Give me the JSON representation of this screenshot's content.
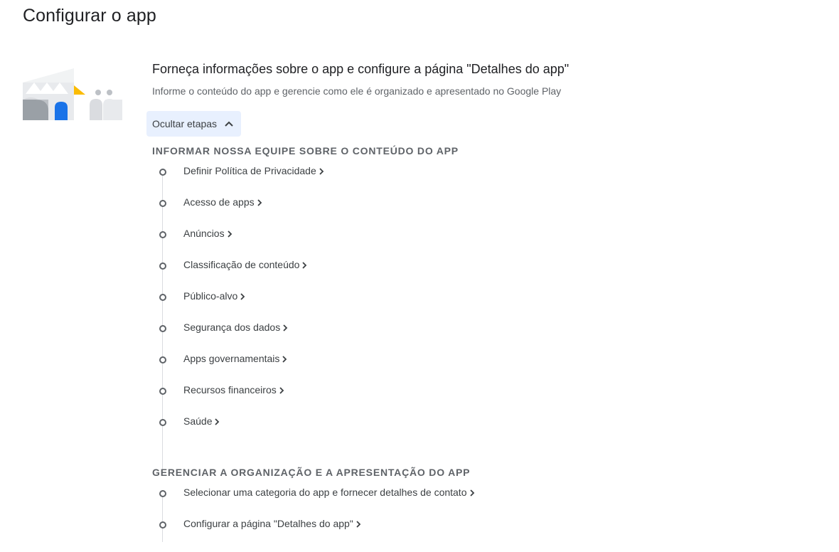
{
  "page": {
    "title": "Configurar o app"
  },
  "intro": {
    "heading": "Forneça informações sobre o app e configure a página \"Detalhes do app\"",
    "description": "Informe o conteúdo do app e gerencie como ele é organizado e apresentado no Google Play"
  },
  "toggle": {
    "label": "Ocultar etapas",
    "icon": "chevron-up-icon"
  },
  "groups": [
    {
      "title": "INFORMAR NOSSA EQUIPE SOBRE O CONTEÚDO DO APP",
      "steps": [
        "Definir Política de Privacidade",
        "Acesso de apps",
        "Anúncios",
        "Classificação de conteúdo",
        "Público-alvo",
        "Segurança dos dados",
        "Apps governamentais",
        "Recursos financeiros",
        "Saúde"
      ]
    },
    {
      "title": "GERENCIAR A ORGANIZAÇÃO E A APRESENTAÇÃO DO APP",
      "steps": [
        "Selecionar uma categoria do app e fornecer detalhes de contato",
        "Configurar a página \"Detalhes do app\""
      ]
    }
  ],
  "colors": {
    "accent": "#1a73e8",
    "toggle_bg": "#e8f0fe",
    "muted": "#5f6368",
    "yellow": "#fbbc04"
  }
}
